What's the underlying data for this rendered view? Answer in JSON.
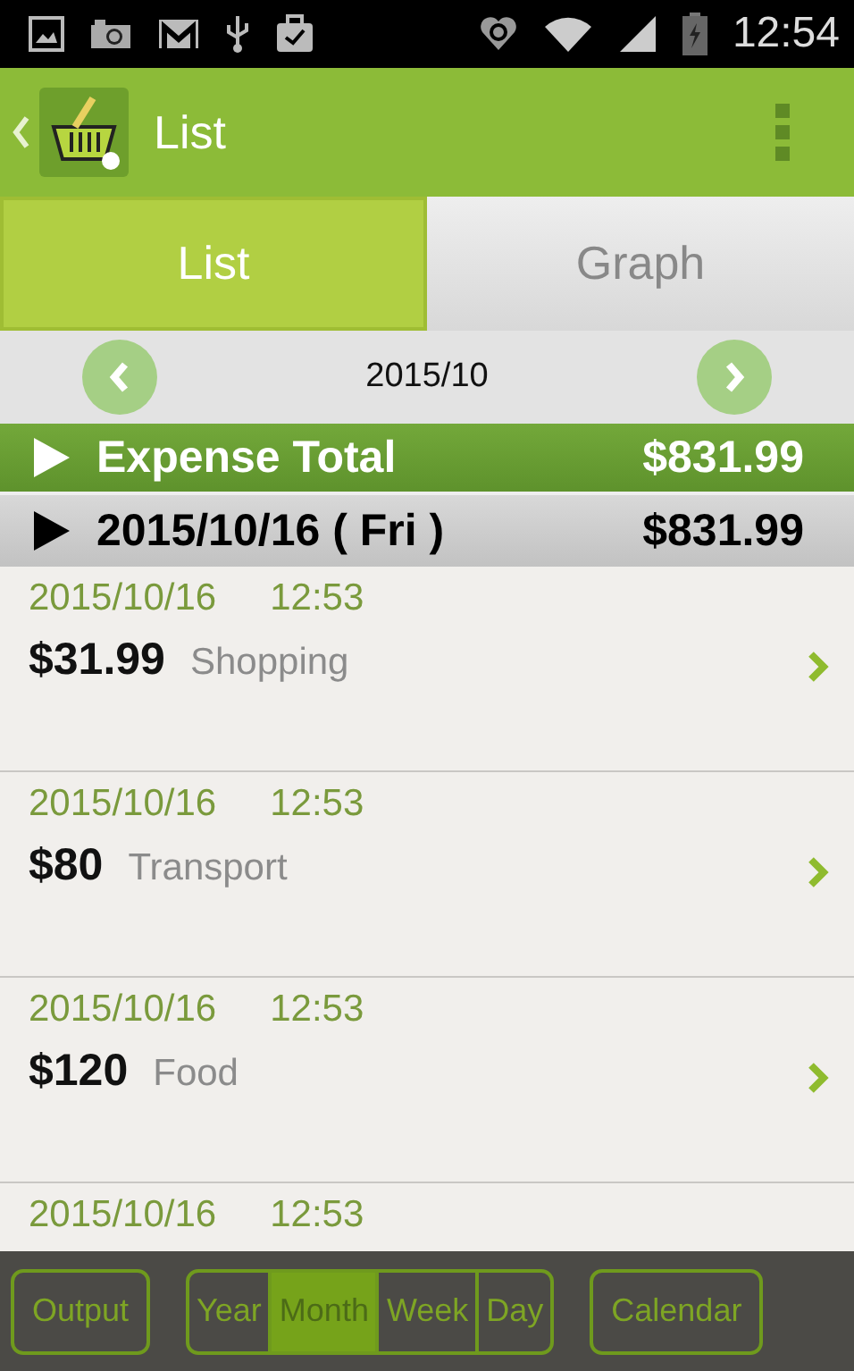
{
  "status_bar": {
    "time": "12:54"
  },
  "app_bar": {
    "title": "List"
  },
  "tabs": [
    {
      "label": "List",
      "selected": true
    },
    {
      "label": "Graph",
      "selected": false
    }
  ],
  "month_nav": {
    "label": "2015/10"
  },
  "expense_total": {
    "label": "Expense Total",
    "amount": "$831.99"
  },
  "day_header": {
    "label": "2015/10/16 ( Fri )",
    "amount": "$831.99"
  },
  "entries": [
    {
      "date": "2015/10/16",
      "time": "12:53",
      "amount": "$31.99",
      "category": "Shopping"
    },
    {
      "date": "2015/10/16",
      "time": "12:53",
      "amount": "$80",
      "category": "Transport"
    },
    {
      "date": "2015/10/16",
      "time": "12:53",
      "amount": "$120",
      "category": "Food"
    },
    {
      "date": "2015/10/16",
      "time": "12:53"
    }
  ],
  "bottom_bar": {
    "output": "Output",
    "periods": [
      {
        "label": "Year",
        "selected": false
      },
      {
        "label": "Month",
        "selected": true
      },
      {
        "label": "Week",
        "selected": false
      },
      {
        "label": "Day",
        "selected": false
      }
    ],
    "calendar": "Calendar"
  }
}
